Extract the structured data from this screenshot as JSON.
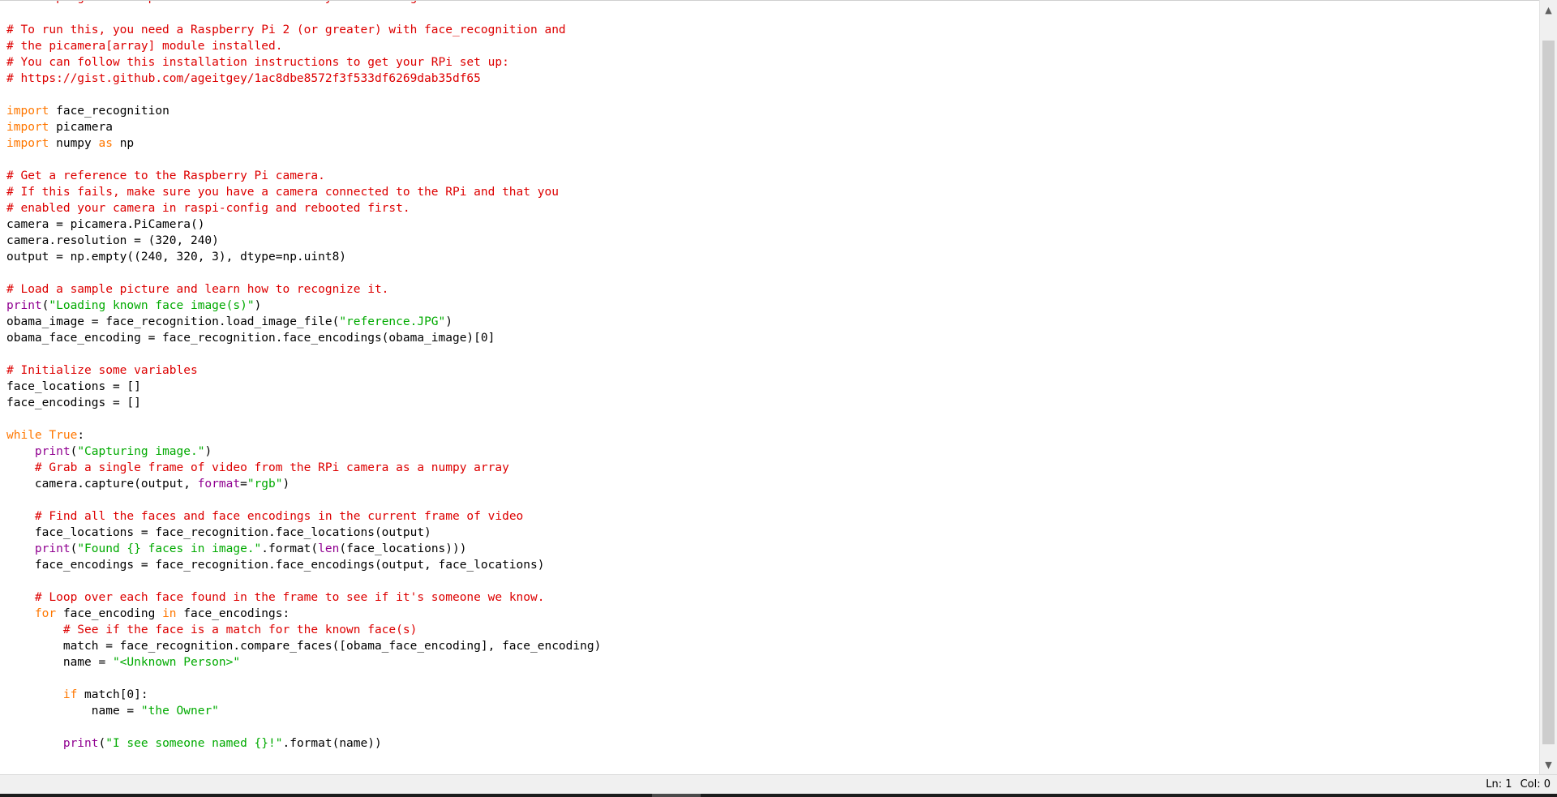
{
  "code_lines": [
    [
      [
        "c",
        "# This program will print out the names of anyone it recognizes to the console."
      ]
    ],
    [],
    [
      [
        "c",
        "# To run this, you need a Raspberry Pi 2 (or greater) with face_recognition and"
      ]
    ],
    [
      [
        "c",
        "# the picamera[array] module installed."
      ]
    ],
    [
      [
        "c",
        "# You can follow this installation instructions to get your RPi set up:"
      ]
    ],
    [
      [
        "c",
        "# https://gist.github.com/ageitgey/1ac8dbe8572f3f533df6269dab35df65"
      ]
    ],
    [],
    [
      [
        "k",
        "import"
      ],
      [
        "t",
        " face_recognition"
      ]
    ],
    [
      [
        "k",
        "import"
      ],
      [
        "t",
        " picamera"
      ]
    ],
    [
      [
        "k",
        "import"
      ],
      [
        "t",
        " numpy "
      ],
      [
        "k",
        "as"
      ],
      [
        "t",
        " np"
      ]
    ],
    [],
    [
      [
        "c",
        "# Get a reference to the Raspberry Pi camera."
      ]
    ],
    [
      [
        "c",
        "# If this fails, make sure you have a camera connected to the RPi and that you"
      ]
    ],
    [
      [
        "c",
        "# enabled your camera in raspi-config and rebooted first."
      ]
    ],
    [
      [
        "t",
        "camera = picamera.PiCamera()"
      ]
    ],
    [
      [
        "t",
        "camera.resolution = (320, 240)"
      ]
    ],
    [
      [
        "t",
        "output = np.empty((240, 320, 3), dtype=np.uint8)"
      ]
    ],
    [],
    [
      [
        "c",
        "# Load a sample picture and learn how to recognize it."
      ]
    ],
    [
      [
        "b",
        "print"
      ],
      [
        "t",
        "("
      ],
      [
        "s",
        "\"Loading known face image(s)\""
      ],
      [
        "t",
        ")"
      ]
    ],
    [
      [
        "t",
        "obama_image = face_recognition.load_image_file("
      ],
      [
        "s",
        "\"reference.JPG\""
      ],
      [
        "t",
        ")"
      ]
    ],
    [
      [
        "t",
        "obama_face_encoding = face_recognition.face_encodings(obama_image)[0]"
      ]
    ],
    [],
    [
      [
        "c",
        "# Initialize some variables"
      ]
    ],
    [
      [
        "t",
        "face_locations = []"
      ]
    ],
    [
      [
        "t",
        "face_encodings = []"
      ]
    ],
    [],
    [
      [
        "k",
        "while"
      ],
      [
        "t",
        " "
      ],
      [
        "k",
        "True"
      ],
      [
        "t",
        ":"
      ]
    ],
    [
      [
        "t",
        "    "
      ],
      [
        "b",
        "print"
      ],
      [
        "t",
        "("
      ],
      [
        "s",
        "\"Capturing image.\""
      ],
      [
        "t",
        ")"
      ]
    ],
    [
      [
        "t",
        "    "
      ],
      [
        "c",
        "# Grab a single frame of video from the RPi camera as a numpy array"
      ]
    ],
    [
      [
        "t",
        "    camera.capture(output, "
      ],
      [
        "b",
        "format"
      ],
      [
        "t",
        "="
      ],
      [
        "s",
        "\"rgb\""
      ],
      [
        "t",
        ")"
      ]
    ],
    [],
    [
      [
        "t",
        "    "
      ],
      [
        "c",
        "# Find all the faces and face encodings in the current frame of video"
      ]
    ],
    [
      [
        "t",
        "    face_locations = face_recognition.face_locations(output)"
      ]
    ],
    [
      [
        "t",
        "    "
      ],
      [
        "b",
        "print"
      ],
      [
        "t",
        "("
      ],
      [
        "s",
        "\"Found {} faces in image.\""
      ],
      [
        "t",
        ".format("
      ],
      [
        "b",
        "len"
      ],
      [
        "t",
        "(face_locations)))"
      ]
    ],
    [
      [
        "t",
        "    face_encodings = face_recognition.face_encodings(output, face_locations)"
      ]
    ],
    [],
    [
      [
        "t",
        "    "
      ],
      [
        "c",
        "# Loop over each face found in the frame to see if it's someone we know."
      ]
    ],
    [
      [
        "t",
        "    "
      ],
      [
        "k",
        "for"
      ],
      [
        "t",
        " face_encoding "
      ],
      [
        "k",
        "in"
      ],
      [
        "t",
        " face_encodings:"
      ]
    ],
    [
      [
        "t",
        "        "
      ],
      [
        "c",
        "# See if the face is a match for the known face(s)"
      ]
    ],
    [
      [
        "t",
        "        match = face_recognition.compare_faces([obama_face_encoding], face_encoding)"
      ]
    ],
    [
      [
        "t",
        "        name = "
      ],
      [
        "s",
        "\"<Unknown Person>\""
      ]
    ],
    [],
    [
      [
        "t",
        "        "
      ],
      [
        "k",
        "if"
      ],
      [
        "t",
        " match[0]:"
      ]
    ],
    [
      [
        "t",
        "            name = "
      ],
      [
        "s",
        "\"the Owner\""
      ]
    ],
    [],
    [
      [
        "t",
        "        "
      ],
      [
        "b",
        "print"
      ],
      [
        "t",
        "("
      ],
      [
        "s",
        "\"I see someone named {}!\""
      ],
      [
        "t",
        ".format(name))"
      ]
    ]
  ],
  "statusbar": {
    "line": "Ln: 1",
    "col": "Col: 0"
  },
  "scrollbar": {
    "up_icon": "▲",
    "down_icon": "▼"
  },
  "colors": {
    "comment": "#dd0000",
    "keyword": "#ff7700",
    "builtin": "#900090",
    "string": "#00aa00"
  }
}
